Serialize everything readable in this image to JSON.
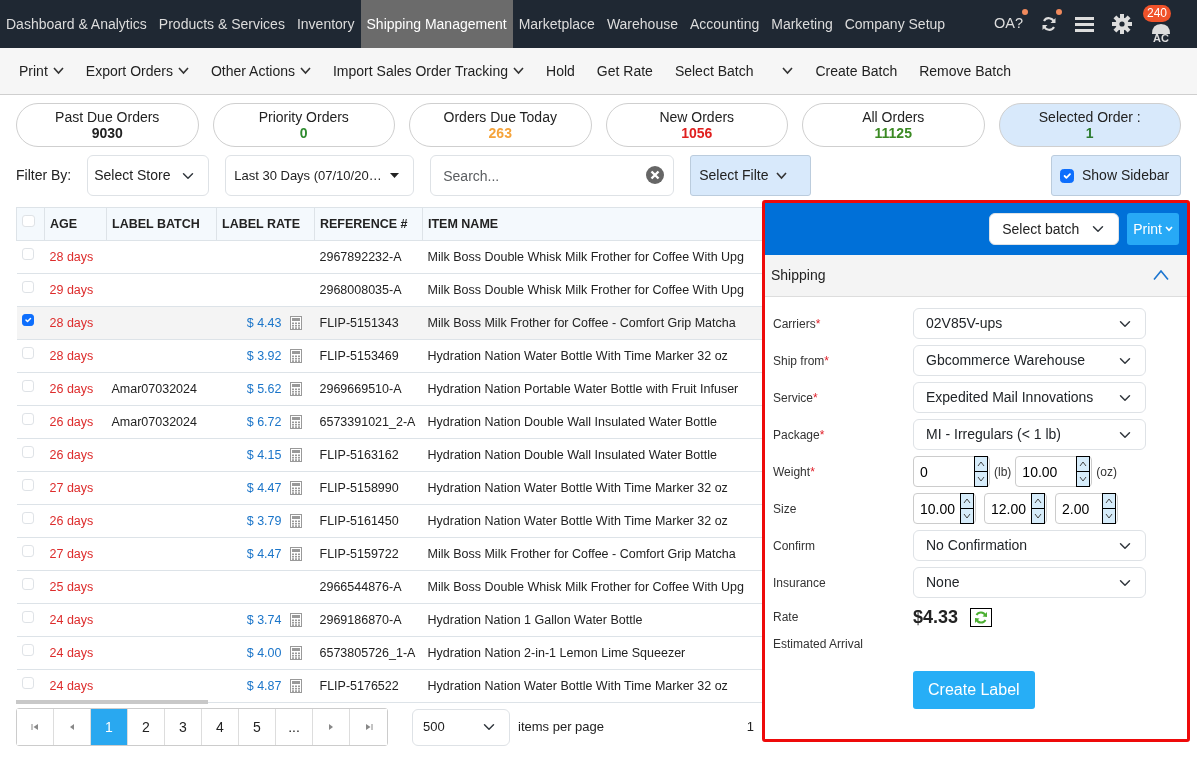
{
  "top_nav": {
    "items": [
      {
        "label": "Dashboard & Analytics",
        "selected": false
      },
      {
        "label": "Products & Services",
        "selected": false
      },
      {
        "label": "Inventory",
        "selected": false
      },
      {
        "label": "Shipping Management",
        "selected": true
      },
      {
        "label": "Marketplace",
        "selected": false
      },
      {
        "label": "Warehouse",
        "selected": false
      },
      {
        "label": "Accounting",
        "selected": false
      },
      {
        "label": "Marketing",
        "selected": false
      },
      {
        "label": "Company Setup",
        "selected": false
      }
    ],
    "tools": [
      {
        "kind": "text",
        "label": "OA?",
        "notify": true
      },
      {
        "kind": "refresh",
        "notify": true
      },
      {
        "kind": "menu",
        "notify": false
      },
      {
        "kind": "settings",
        "notify": false
      },
      {
        "kind": "user",
        "badge": "240",
        "initials": "AC",
        "notify": false
      }
    ]
  },
  "toolbar": [
    {
      "label": "Print",
      "dropdown": true
    },
    {
      "label": "Export Orders",
      "dropdown": true
    },
    {
      "label": "Other Actions",
      "dropdown": true
    },
    {
      "label": "Import Sales Order Tracking",
      "dropdown": true
    },
    {
      "label": "Hold",
      "dropdown": false
    },
    {
      "label": "Get Rate",
      "dropdown": false
    },
    {
      "label": "Select Batch",
      "dropdown": true
    },
    {
      "label": "Create Batch",
      "dropdown": false
    },
    {
      "label": "Remove Batch",
      "dropdown": false
    }
  ],
  "stats": [
    {
      "label": "Past Due Orders",
      "value": "9030",
      "color": "#222222",
      "selected": false
    },
    {
      "label": "Priority Orders",
      "value": "0",
      "color": "#2e8b2e",
      "selected": false
    },
    {
      "label": "Orders Due Today",
      "value": "263",
      "color": "#f5a33a",
      "selected": false
    },
    {
      "label": "New Orders",
      "value": "1056",
      "color": "#e0201f",
      "selected": false
    },
    {
      "label": "All Orders",
      "value": "11125",
      "color": "#3b8a23",
      "selected": false
    },
    {
      "label": "Selected Order :",
      "value": "1",
      "color": "#2e7d32",
      "selected": true
    }
  ],
  "filters": {
    "label": "Filter By:",
    "store": "Select Store",
    "date_range": "Last 30 Days (07/10/20…",
    "search_placeholder": "Search...",
    "filter_button": "Select Filte",
    "show_sidebar": {
      "label": "Show Sidebar",
      "checked": true
    }
  },
  "table": {
    "select_all": false,
    "columns": [
      "AGE",
      "LABEL BATCH",
      "LABEL RATE",
      "REFERENCE #",
      "ITEM NAME"
    ],
    "rows": [
      {
        "selected": false,
        "age": "28 days",
        "label_batch": "",
        "label_rate": "",
        "reference": "2967892232-A",
        "item_name": "Milk Boss Double Whisk Milk Frother for Coffee With Upg"
      },
      {
        "selected": false,
        "age": "29 days",
        "label_batch": "",
        "label_rate": "",
        "reference": "2968008035-A",
        "item_name": "Milk Boss Double Whisk Milk Frother for Coffee With Upg"
      },
      {
        "selected": true,
        "age": "28 days",
        "label_batch": "",
        "label_rate": "$ 4.43",
        "reference": "FLIP-5151343",
        "item_name": "Milk Boss Milk Frother for Coffee - Comfort Grip Matcha"
      },
      {
        "selected": false,
        "age": "28 days",
        "label_batch": "",
        "label_rate": "$ 3.92",
        "reference": "FLIP-5153469",
        "item_name": "Hydration Nation Water Bottle With Time Marker 32 oz"
      },
      {
        "selected": false,
        "age": "26 days",
        "label_batch": "Amar07032024",
        "label_rate": "$ 5.62",
        "reference": "2969669510-A",
        "item_name": "Hydration Nation Portable Water Bottle with Fruit Infuser"
      },
      {
        "selected": false,
        "age": "26 days",
        "label_batch": "Amar07032024",
        "label_rate": "$ 6.72",
        "reference": "6573391021_2-A",
        "item_name": "Hydration Nation Double Wall Insulated Water Bottle"
      },
      {
        "selected": false,
        "age": "26 days",
        "label_batch": "",
        "label_rate": "$ 4.15",
        "reference": "FLIP-5163162",
        "item_name": "Hydration Nation Double Wall Insulated Water Bottle"
      },
      {
        "selected": false,
        "age": "27 days",
        "label_batch": "",
        "label_rate": "$ 4.47",
        "reference": "FLIP-5158990",
        "item_name": "Hydration Nation Water Bottle With Time Marker 32 oz"
      },
      {
        "selected": false,
        "age": "26 days",
        "label_batch": "",
        "label_rate": "$ 3.79",
        "reference": "FLIP-5161450",
        "item_name": "Hydration Nation Water Bottle With Time Marker 32 oz"
      },
      {
        "selected": false,
        "age": "27 days",
        "label_batch": "",
        "label_rate": "$ 4.47",
        "reference": "FLIP-5159722",
        "item_name": "Milk Boss Milk Frother for Coffee - Comfort Grip Matcha"
      },
      {
        "selected": false,
        "age": "25 days",
        "label_batch": "",
        "label_rate": "",
        "reference": "2966544876-A",
        "item_name": "Milk Boss Double Whisk Milk Frother for Coffee With Upg"
      },
      {
        "selected": false,
        "age": "24 days",
        "label_batch": "",
        "label_rate": "$ 3.74",
        "reference": "2969186870-A",
        "item_name": "Hydration Nation 1 Gallon Water Bottle"
      },
      {
        "selected": false,
        "age": "24 days",
        "label_batch": "",
        "label_rate": "$ 4.00",
        "reference": "6573805726_1-A",
        "item_name": "Hydration Nation 2-in-1 Lemon Lime Squeezer"
      },
      {
        "selected": false,
        "age": "24 days",
        "label_batch": "",
        "label_rate": "$ 4.87",
        "reference": "FLIP-5176522",
        "item_name": "Hydration Nation Water Bottle With Time Marker 32 oz"
      }
    ]
  },
  "pagination": {
    "pages": [
      {
        "label": "1",
        "selected": true
      },
      {
        "label": "2",
        "selected": false
      },
      {
        "label": "3",
        "selected": false
      },
      {
        "label": "4",
        "selected": false
      },
      {
        "label": "5",
        "selected": false
      },
      {
        "label": "...",
        "selected": false
      }
    ],
    "page_size": "500",
    "page_size_label": "items per page",
    "info": "1"
  },
  "sidebar": {
    "batch_select": "Select batch",
    "print_button": "Print",
    "section": {
      "title": "Shipping",
      "expanded": true
    },
    "fields": [
      {
        "kind": "select",
        "label": "Carriers",
        "required_mark": "*",
        "value": "02V85V-ups"
      },
      {
        "kind": "select",
        "label": "Ship from",
        "required_mark": "*",
        "value": "Gbcommerce Warehouse"
      },
      {
        "kind": "select",
        "label": "Service",
        "required_mark": "*",
        "value": "Expedited Mail Innovations"
      },
      {
        "kind": "select",
        "label": "Package",
        "required_mark": "*",
        "value": "MI - Irregulars (< 1 lb)"
      },
      {
        "kind": "spinners",
        "label": "Weight",
        "required_mark": "*",
        "inputs": [
          {
            "value": "0",
            "unit": "(lb)"
          },
          {
            "value": "10.00",
            "unit": "(oz)"
          }
        ]
      },
      {
        "kind": "spinners",
        "label": "Size",
        "inputs": [
          {
            "value": "10.00"
          },
          {
            "value": "12.00"
          },
          {
            "value": "2.00"
          }
        ]
      },
      {
        "kind": "select",
        "label": "Confirm",
        "value": "No Confirmation"
      },
      {
        "kind": "select",
        "label": "Insurance",
        "value": "None"
      },
      {
        "kind": "rate",
        "label": "Rate",
        "value": "$4.33"
      },
      {
        "kind": "plain",
        "label": "Estimated Arrival"
      }
    ],
    "create_button": "Create Label"
  }
}
